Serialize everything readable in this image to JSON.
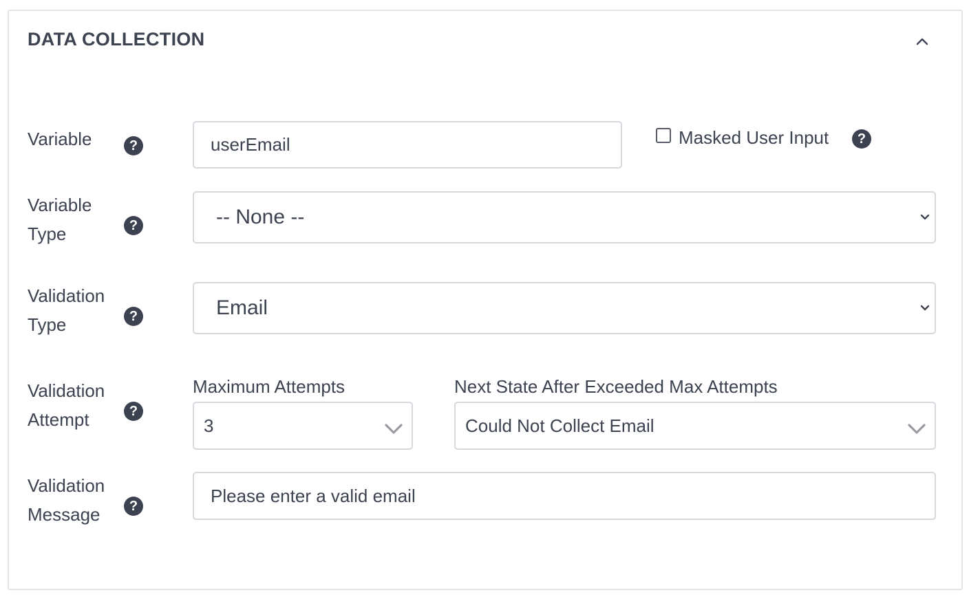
{
  "section": {
    "title": "DATA COLLECTION",
    "toggle_icon": "chevron-up-icon"
  },
  "help_icon_glyph": "?",
  "variable": {
    "label": "Variable",
    "value": "userEmail",
    "masked_checkbox_label": "Masked User Input",
    "masked_checked": false
  },
  "variable_type": {
    "label_line1": "Variable",
    "label_line2": "Type",
    "selected": "-- None --"
  },
  "validation_type": {
    "label_line1": "Validation",
    "label_line2": "Type",
    "selected": "Email"
  },
  "validation_attempt": {
    "label_line1": "Validation",
    "label_line2": "Attempt",
    "max_attempts_label": "Maximum Attempts",
    "max_attempts_value": "3",
    "next_state_label": "Next State After Exceeded Max Attempts",
    "next_state_value": "Could Not Collect Email"
  },
  "validation_message": {
    "label_line1": "Validation",
    "label_line2": "Message",
    "value": "Please enter a valid email"
  },
  "colors": {
    "text": "#3c4250",
    "border": "#d6d8dd",
    "chevron": "#9a9ca2"
  }
}
